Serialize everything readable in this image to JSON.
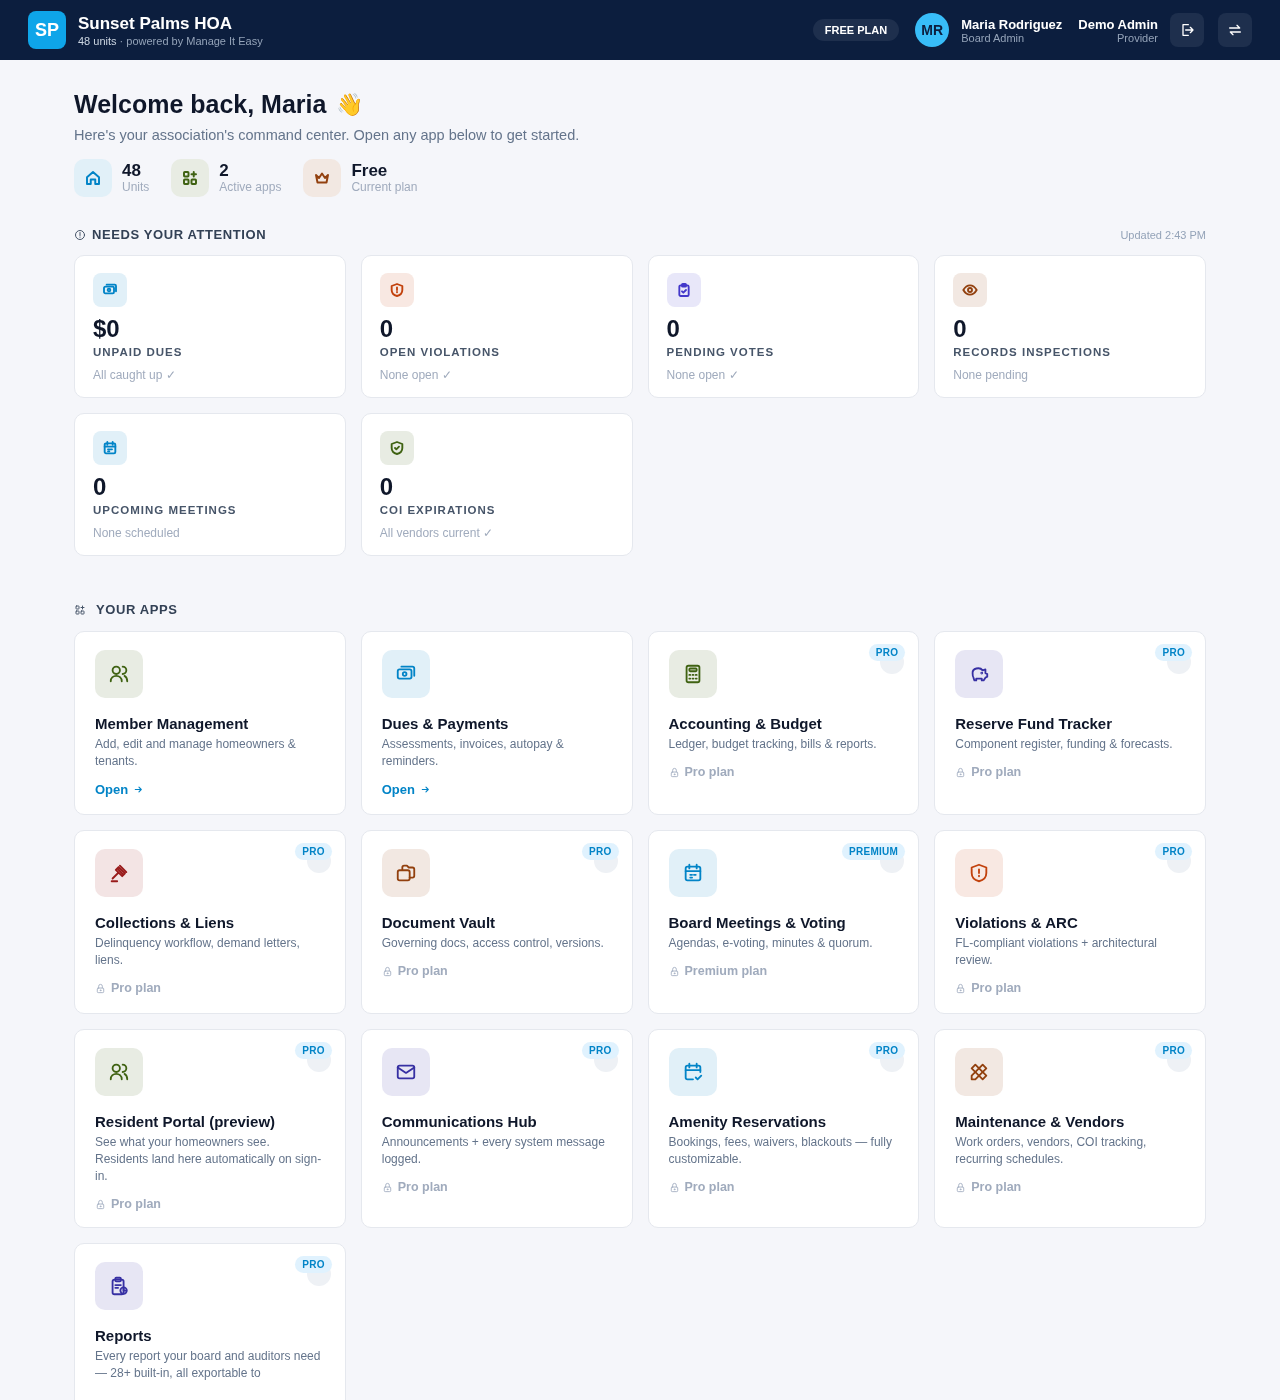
{
  "header": {
    "logo": "SP",
    "title": "Sunset Palms HOA",
    "units": "48 units",
    "powered_by": "· powered by Manage It Easy",
    "plan_badge": "FREE PLAN",
    "user": {
      "initials": "MR",
      "name": "Maria Rodriguez",
      "role": "Board Admin"
    },
    "admin": {
      "name": "Demo Admin",
      "role": "Provider"
    }
  },
  "welcome": {
    "title": "Welcome back, Maria",
    "emoji": "👋",
    "subtitle": "Here's your association's command center. Open any app below to get started."
  },
  "stats": [
    {
      "color": "#0284c7",
      "value": "48",
      "label": "Units"
    },
    {
      "color": "#3f6212",
      "value": "2",
      "label": "Active apps"
    },
    {
      "color": "#92400e",
      "value": "Free",
      "label": "Current plan"
    }
  ],
  "attention": {
    "title": "NEEDS YOUR ATTENTION",
    "updated": "Updated 2:43 PM",
    "cards": [
      {
        "color": "#0284c7",
        "value": "$0",
        "label": "UNPAID DUES",
        "note": "All caught up ✓"
      },
      {
        "color": "#c2410c",
        "value": "0",
        "label": "OPEN VIOLATIONS",
        "note": "None open ✓"
      },
      {
        "color": "#4338ca",
        "value": "0",
        "label": "PENDING VOTES",
        "note": "None open ✓"
      },
      {
        "color": "#92400e",
        "value": "0",
        "label": "RECORDS INSPECTIONS",
        "note": "None pending"
      },
      {
        "color": "#0284c7",
        "value": "0",
        "label": "UPCOMING MEETINGS",
        "note": "None scheduled"
      },
      {
        "color": "#3f6212",
        "value": "0",
        "label": "COI EXPIRATIONS",
        "note": "All vendors current ✓"
      }
    ]
  },
  "apps": {
    "title": "YOUR APPS",
    "items": [
      {
        "color": "#3f6212",
        "name": "Member Management",
        "description": "Add, edit and manage homeowners & tenants.",
        "kind": "open",
        "action": "Open"
      },
      {
        "color": "#0284c7",
        "name": "Dues & Payments",
        "description": "Assessments, invoices, autopay & reminders.",
        "kind": "open",
        "action": "Open"
      },
      {
        "color": "#3f6212",
        "name": "Accounting & Budget",
        "description": "Ledger, budget tracking, bills & reports.",
        "kind": "locked",
        "badge": "PRO",
        "action": "Pro plan"
      },
      {
        "color": "#3730a3",
        "name": "Reserve Fund Tracker",
        "description": "Component register, funding & forecasts.",
        "kind": "locked",
        "badge": "PRO",
        "action": "Pro plan"
      },
      {
        "color": "#991b1b",
        "name": "Collections & Liens",
        "description": "Delinquency workflow, demand letters, liens.",
        "kind": "locked",
        "badge": "PRO",
        "action": "Pro plan"
      },
      {
        "color": "#92400e",
        "name": "Document Vault",
        "description": "Governing docs, access control, versions.",
        "kind": "locked",
        "badge": "PRO",
        "action": "Pro plan"
      },
      {
        "color": "#0284c7",
        "name": "Board Meetings & Voting",
        "description": "Agendas, e-voting, minutes & quorum.",
        "kind": "locked",
        "badge": "PREMIUM",
        "action": "Premium plan"
      },
      {
        "color": "#c2410c",
        "name": "Violations & ARC",
        "description": "FL-compliant violations + architectural review.",
        "kind": "locked",
        "badge": "PRO",
        "action": "Pro plan"
      },
      {
        "color": "#3f6212",
        "name": "Resident Portal (preview)",
        "description": "See what your homeowners see. Residents land here automatically on sign-in.",
        "kind": "locked",
        "badge": "PRO",
        "action": "Pro plan"
      },
      {
        "color": "#3730a3",
        "name": "Communications Hub",
        "description": "Announcements + every system message logged.",
        "kind": "locked",
        "badge": "PRO",
        "action": "Pro plan"
      },
      {
        "color": "#0284c7",
        "name": "Amenity Reservations",
        "description": "Bookings, fees, waivers, blackouts — fully customizable.",
        "kind": "locked",
        "badge": "PRO",
        "action": "Pro plan"
      },
      {
        "color": "#92400e",
        "name": "Maintenance & Vendors",
        "description": "Work orders, vendors, COI tracking, recurring schedules.",
        "kind": "locked",
        "badge": "PRO",
        "action": "Pro plan"
      },
      {
        "color": "#3730a3",
        "name": "Reports",
        "description": "Every report your board and auditors need — 28+ built-in, all exportable to",
        "kind": "locked",
        "badge": "PRO"
      }
    ]
  }
}
